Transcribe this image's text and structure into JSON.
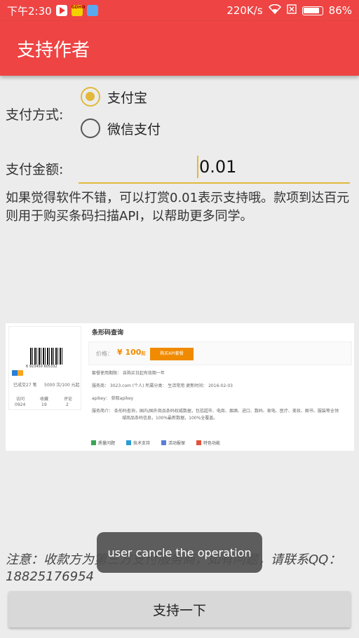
{
  "status_bar": {
    "time": "下午2:30",
    "gdhn_label": "GDHN",
    "network_speed": "220K/s",
    "battery": "86%"
  },
  "app_bar": {
    "title": "支持作者"
  },
  "payment_method": {
    "label": "支付方式:",
    "options": [
      {
        "label": "支付宝",
        "checked": true
      },
      {
        "label": "微信支付",
        "checked": false
      }
    ]
  },
  "amount": {
    "label": "支付金额:",
    "value": "0.01"
  },
  "description": "如果觉得软件不错，可以打赏0.01表示支持哦。款项到达百元则用于购买条码扫描API，以帮助更多同学。",
  "qr_image": {
    "title": "条形码查询",
    "barcode_number": "6 923450 605332",
    "sold": "已成交27 笔",
    "quota": "5000 次/100 元起",
    "stats_labels": [
      "访问",
      "收藏",
      "评论"
    ],
    "stats_values": [
      "0924",
      "19",
      "2"
    ],
    "price_label": "价格：",
    "price": "¥ 100",
    "price_unit": "起",
    "buy_label": "购买API套餐",
    "meta": [
      "套餐使用期限：  自购买日起有效期一年",
      "服务商： 3023.com (个人)      所属分类： 生活常用      更新时间： 2016-02-03",
      "apikey：  获取apikey",
      "服务简介：  条形码查询，国内/国外商品条码权威数据，包括超市、电商、烟酒、进口、数码、家电、医疗、美妆、图书、服装等全领",
      "域商品条码信息，100%最新数据，100%全覆盖。"
    ],
    "footer": [
      "质量问题",
      "技术支持",
      "活动报保",
      "特色功能"
    ]
  },
  "notice": "注意：收款方为第三方支付服务商，如有问题，请联系QQ：18825176954",
  "toast": "user cancle the operation",
  "support_button": "支持一下",
  "colors": {
    "primary": "#ee4444",
    "accent": "#e2b93b"
  }
}
